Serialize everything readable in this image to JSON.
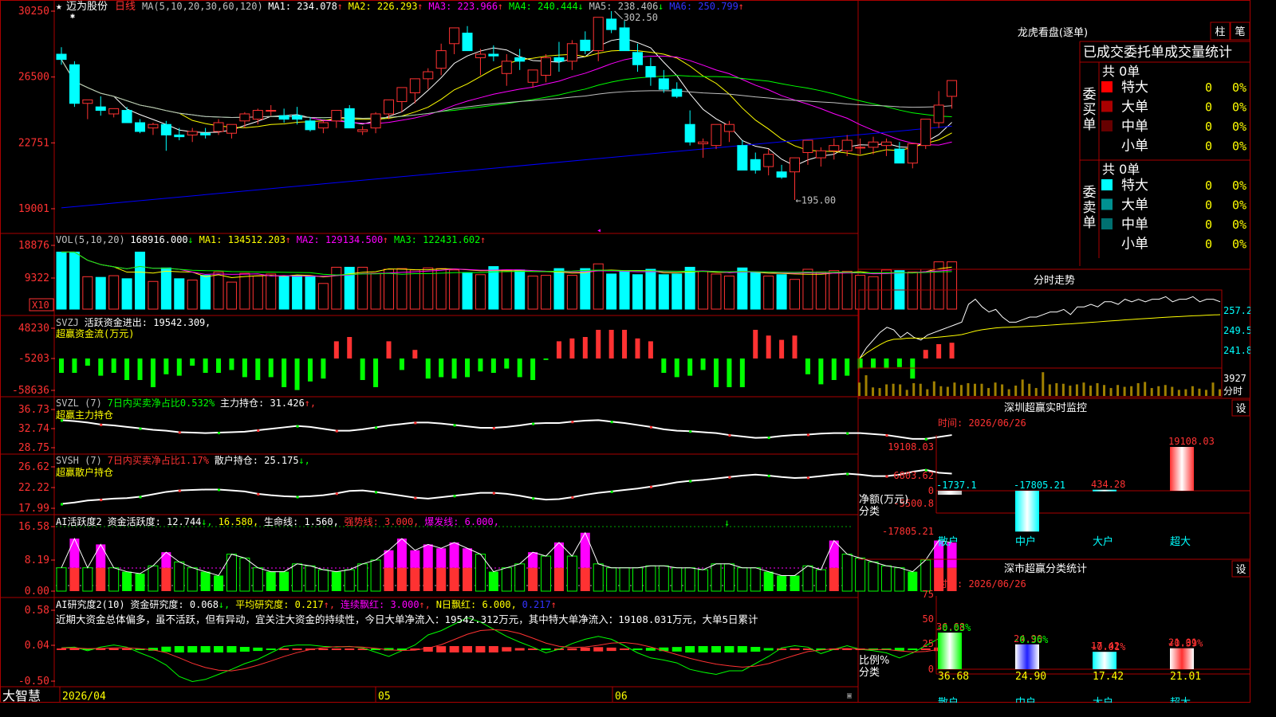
{
  "stock_name": "迈为股份",
  "period_label": "日线",
  "bottom_label": "大智慧",
  "colors": {
    "up": "#ff3232",
    "down": "#00ffff",
    "ma1": "#ffffff",
    "ma2": "#ffff00",
    "ma3": "#ff00ff",
    "ma4": "#00ff00",
    "ma5": "#c0c0c0",
    "ma6": "#0000ff",
    "bg": "#000000",
    "frame": "#aa0000",
    "pink": "#ff00ff",
    "green": "#00ff00",
    "gold": "#ffff00"
  },
  "main": {
    "ma_header": [
      {
        "t": "MA(5,10,20,30,60,120)",
        "c": "#c0c0c0"
      },
      {
        "t": "MA1: 234.078",
        "c": "#ffffff",
        "a": "↑",
        "ac": "#ff3232"
      },
      {
        "t": "MA2: 226.293",
        "c": "#ffff00",
        "a": "↑",
        "ac": "#ff3232"
      },
      {
        "t": "MA3: 223.966",
        "c": "#ff00ff",
        "a": "↑",
        "ac": "#ff3232"
      },
      {
        "t": "MA4: 240.444",
        "c": "#00ff00",
        "a": "↓",
        "ac": "#00ff00"
      },
      {
        "t": "MA5: 238.406",
        "c": "#c0c0c0",
        "a": "↓",
        "ac": "#00ff00"
      },
      {
        "t": "MA6: 250.799",
        "c": "#3333ff",
        "a": "↑",
        "ac": "#ff3232"
      }
    ],
    "y_ticks": [
      "30250",
      "26500",
      "22751",
      "19001"
    ],
    "high_label": "302.50",
    "low_label": "←195.00",
    "x_labels": [
      "2026/04",
      "05",
      "06"
    ]
  },
  "vol": {
    "header": [
      {
        "t": "VOL(5,10,20)",
        "c": "#c0c0c0"
      },
      {
        "t": "168916.000",
        "c": "#ffffff",
        "a": "↓",
        "ac": "#00ff00"
      },
      {
        "t": "MA1: 134512.203",
        "c": "#ffff00",
        "a": "↑",
        "ac": "#ff3232"
      },
      {
        "t": "MA2: 129134.500",
        "c": "#ff00ff",
        "a": "↑",
        "ac": "#ff3232"
      },
      {
        "t": "MA3: 122431.602",
        "c": "#00ff00",
        "a": "↑",
        "ac": "#ff3232"
      }
    ],
    "y_ticks": [
      "18876",
      "9322"
    ],
    "unit": "X10"
  },
  "svzj": {
    "header": [
      {
        "t": "SVZJ",
        "c": "#c0c0c0"
      },
      {
        "t": "活跃资金进出: 19542.309",
        "c": "#ffffff",
        "a": ",",
        "ac": "#ffffff"
      }
    ],
    "sub": "超赢资金流(万元)",
    "y_ticks": [
      "48230",
      "-5203",
      "-58636"
    ]
  },
  "svzl": {
    "header": [
      {
        "t": "SVZL (7)",
        "c": "#c0c0c0"
      },
      {
        "t": "7日内买卖净占比0.532%",
        "c": "#00ff00"
      },
      {
        "t": "主力持仓: 31.426",
        "c": "#ffffff",
        "a": "↑,",
        "ac": "#ff3232"
      }
    ],
    "sub": "超赢主力持仓",
    "y_ticks": [
      "36.73",
      "32.74",
      "28.75"
    ]
  },
  "svsh": {
    "header": [
      {
        "t": "SVSH (7)",
        "c": "#c0c0c0"
      },
      {
        "t": "7日内买卖净占比1.17%",
        "c": "#ff3232"
      },
      {
        "t": "散户持仓: 25.175",
        "c": "#ffffff",
        "a": "↓,",
        "ac": "#00ff00"
      }
    ],
    "sub": "超赢散户持仓",
    "y_ticks": [
      "26.62",
      "22.22",
      "17.99"
    ]
  },
  "aihy": {
    "header": [
      {
        "t": "AI活跃度2",
        "c": "#ffffff"
      },
      {
        "t": "资金活跃度: 12.744",
        "c": "#ffffff",
        "a": "↓,",
        "ac": "#00ff00"
      },
      {
        "t": "16.580,",
        "c": "#ffff00"
      },
      {
        "t": "生命线: 1.560,",
        "c": "#ffffff"
      },
      {
        "t": "强势线: 3.000,",
        "c": "#ff3232"
      },
      {
        "t": "爆发线: 6.000,",
        "c": "#ff00ff"
      }
    ],
    "y_ticks": [
      "16.58",
      "8.19",
      "0.00"
    ]
  },
  "aiyj": {
    "header": [
      {
        "t": "AI研究度2(10)",
        "c": "#ffffff"
      },
      {
        "t": "资金研究度: 0.068",
        "c": "#ffffff",
        "a": "↓,",
        "ac": "#00ff00"
      },
      {
        "t": "平均研究度: 0.217",
        "c": "#ffff00",
        "a": "↑,",
        "ac": "#ff3232"
      },
      {
        "t": "连续飘红: 3.000",
        "c": "#ff00ff",
        "a": "↑,",
        "ac": "#ff3232"
      },
      {
        "t": "N日飘红: 6.000,",
        "c": "#ffff00"
      },
      {
        "t": "0.217",
        "c": "#3333ff",
        "a": "↑",
        "ac": "#ff3232"
      }
    ],
    "comment": "近期大资金总体偏多，虽不活跃，但有异动，宜关注大资金的持续性，今日大单净流入：19542.312万元，其中特大单净流入：19108.031万元，大单5日累计",
    "y_ticks": [
      "0.58",
      "0.04",
      "-0.50"
    ]
  },
  "right": {
    "lhb": {
      "title": "龙虎看盘(逐单)",
      "btn1": "柱",
      "btn2": "笔",
      "subtitle": "已成交委托单成交量统计",
      "buy": {
        "side": "委买单",
        "total": "共 0单",
        "rows": [
          {
            "label": "特大",
            "color": "#ff0000",
            "v": "0",
            "p": "0%"
          },
          {
            "label": "大单",
            "color": "#aa0000",
            "v": "0",
            "p": "0%"
          },
          {
            "label": "中单",
            "color": "#660000",
            "v": "0",
            "p": "0%"
          },
          {
            "label": "小单",
            "color": "#000000",
            "v": "0",
            "p": "0%"
          }
        ]
      },
      "sell": {
        "side": "委卖单",
        "total": "共 0单",
        "rows": [
          {
            "label": "特大",
            "color": "#00ffff",
            "v": "0",
            "p": "0%"
          },
          {
            "label": "大单",
            "color": "#009090",
            "v": "0",
            "p": "0%"
          },
          {
            "label": "中单",
            "color": "#007070",
            "v": "0",
            "p": "0%"
          },
          {
            "label": "小单",
            "color": "#000000",
            "v": "0",
            "p": "0%"
          }
        ]
      }
    },
    "fenshi": {
      "title": "分时走势",
      "ticks": [
        "257.2",
        "249.5",
        "241.8"
      ],
      "vol_tick": "3927",
      "unit": "分时"
    },
    "monitor": {
      "title": "深圳超赢实时监控",
      "btn": "设",
      "time": "时间: 2026/06/26",
      "y_ticks": [
        "19108.03",
        "6803.62",
        "0",
        "-5500.8",
        "-17805.21"
      ],
      "y_label": "净额(万元)",
      "x_title": "分类",
      "chart_data": {
        "type": "bar",
        "categories": [
          "散户",
          "中户",
          "大户",
          "超大"
        ],
        "values": [
          -1737.1,
          -17805.21,
          434.28,
          19108.03
        ],
        "labels": [
          "-1737.1",
          "-17805.21",
          "434.28",
          "19108.03"
        ],
        "ylim": [
          -17805.21,
          19108.03
        ]
      }
    },
    "classify": {
      "title": "深市超赢分类统计",
      "btn": "设",
      "time": "时间: 2026/06/26",
      "y_ticks": [
        "75",
        "50",
        "25",
        "0"
      ],
      "y_label": "比例%",
      "x_title": "分类",
      "chart_data": {
        "type": "bar",
        "categories": [
          "散户",
          "中户",
          "大户",
          "超大"
        ],
        "values": [
          36.68,
          24.9,
          17.42,
          21.01
        ],
        "labels": [
          "36.68",
          "24.90",
          "17.42",
          "21.01"
        ],
        "changes": [
          "-0.03%",
          "-0.36%",
          "+0.01%",
          "+0.39%"
        ],
        "ylim": [
          0,
          75
        ]
      }
    }
  },
  "chart_data": {
    "type": "candlestick",
    "ylim": [
      190.01,
      302.5
    ],
    "candles": [
      [
        278,
        282,
        272,
        275
      ],
      [
        272,
        274,
        248,
        250
      ],
      [
        250,
        252,
        241,
        252
      ],
      [
        248,
        254,
        243,
        246
      ],
      [
        244,
        247,
        242,
        247
      ],
      [
        246,
        248,
        239,
        239
      ],
      [
        239,
        241,
        233,
        234
      ],
      [
        236,
        239,
        232,
        238
      ],
      [
        238,
        240,
        223,
        232
      ],
      [
        232,
        236,
        229,
        231
      ],
      [
        232,
        236,
        228,
        234
      ],
      [
        233,
        236,
        230,
        232
      ],
      [
        234,
        241,
        232,
        239
      ],
      [
        233,
        238,
        230,
        238
      ],
      [
        240,
        245,
        236,
        244
      ],
      [
        241,
        247,
        238,
        246
      ],
      [
        246,
        249,
        243,
        246
      ],
      [
        243,
        247,
        239,
        241
      ],
      [
        243,
        248,
        238,
        241
      ],
      [
        240,
        242,
        234,
        235
      ],
      [
        236,
        240,
        233,
        239
      ],
      [
        240,
        246,
        236,
        246
      ],
      [
        247,
        249,
        236,
        236
      ],
      [
        234,
        237,
        232,
        235
      ],
      [
        236,
        245,
        233,
        244
      ],
      [
        244,
        252,
        241,
        252
      ],
      [
        251,
        259,
        245,
        259
      ],
      [
        256,
        264,
        250,
        264
      ],
      [
        264,
        270,
        258,
        268
      ],
      [
        270,
        284,
        266,
        280
      ],
      [
        284,
        293,
        278,
        293
      ],
      [
        290,
        294,
        280,
        280
      ],
      [
        276,
        281,
        266,
        278
      ],
      [
        278,
        283,
        274,
        277
      ],
      [
        267,
        278,
        260,
        274
      ],
      [
        276,
        281,
        269,
        274
      ],
      [
        262,
        269,
        259,
        269
      ],
      [
        266,
        278,
        262,
        276
      ],
      [
        276,
        285,
        268,
        274
      ],
      [
        274,
        286,
        269,
        284
      ],
      [
        286,
        291,
        278,
        280
      ],
      [
        280,
        299,
        274,
        299
      ],
      [
        298,
        302.5,
        290,
        292
      ],
      [
        293,
        297,
        280,
        280
      ],
      [
        279,
        284,
        268,
        272
      ],
      [
        271,
        276,
        260,
        265
      ],
      [
        264,
        269,
        256,
        258
      ],
      [
        258,
        262,
        253,
        254
      ],
      [
        238,
        246,
        226,
        228
      ],
      [
        227,
        230,
        219,
        228
      ],
      [
        226,
        238,
        224,
        238
      ],
      [
        234,
        240,
        228,
        238
      ],
      [
        226,
        229,
        216,
        212
      ],
      [
        218,
        222,
        210,
        212
      ],
      [
        214,
        224,
        209,
        221
      ],
      [
        211,
        215,
        207,
        208
      ],
      [
        211,
        219,
        195,
        219
      ],
      [
        222,
        229,
        215,
        229
      ],
      [
        219,
        225,
        214,
        223
      ],
      [
        223,
        230,
        218,
        226
      ],
      [
        223,
        232,
        220,
        229
      ],
      [
        225,
        230,
        221,
        225
      ],
      [
        225,
        231,
        221,
        228
      ],
      [
        226,
        230,
        220,
        228
      ],
      [
        224,
        228,
        217,
        216
      ],
      [
        216,
        226,
        213,
        227
      ],
      [
        226,
        241,
        224,
        241
      ],
      [
        239,
        257,
        236,
        249
      ],
      [
        254,
        261,
        247,
        263
      ]
    ],
    "volume": [
      168916,
      168916,
      96000,
      94000,
      99000,
      90000,
      168916,
      82000,
      122000,
      90000,
      86000,
      100000,
      110000,
      80000,
      106000,
      98000,
      104000,
      98000,
      100000,
      98000,
      76000,
      124000,
      124000,
      124000,
      106000,
      118000,
      120000,
      116000,
      122000,
      120000,
      116000,
      108000,
      102000,
      126000,
      116000,
      116000,
      98000,
      100000,
      120000,
      100000,
      120000,
      134000,
      104000,
      112000,
      102000,
      118000,
      102000,
      104000,
      124000,
      112000,
      104000,
      98000,
      122000,
      110000,
      98000,
      102000,
      88000,
      118000,
      110000,
      114000,
      112000,
      100000,
      96000,
      116000,
      114000,
      110000,
      118000,
      140000,
      140000
    ],
    "svzj": [
      -10,
      -10,
      -5,
      -12,
      -10,
      -15,
      -15,
      -20,
      -11,
      -12,
      -5,
      -10,
      -10,
      -8,
      -13,
      -15,
      -13,
      -20,
      -22,
      -16,
      -14,
      12,
      15,
      -15,
      -20,
      12,
      -8,
      6,
      -14,
      -13,
      -14,
      -13,
      -9,
      -10,
      -7,
      -13,
      -15,
      -1,
      12,
      14,
      15,
      20,
      20,
      20,
      14,
      12,
      -10,
      -13,
      -12,
      -8,
      -20,
      -20,
      -20,
      20,
      16,
      13,
      16,
      -11,
      -18,
      -15,
      -12,
      -7,
      -7,
      -7,
      -6,
      -14,
      6,
      10,
      11
    ],
    "svzl": [
      34.5,
      34.3,
      34.0,
      33.6,
      33.4,
      33.1,
      32.8,
      32.5,
      32.3,
      32.0,
      31.9,
      31.8,
      31.9,
      32.0,
      32.1,
      32.4,
      32.7,
      33.0,
      33.3,
      33.1,
      32.7,
      32.3,
      32.3,
      32.6,
      33.0,
      33.4,
      33.7,
      34.0,
      34.0,
      33.8,
      33.5,
      33.2,
      32.9,
      32.9,
      33.1,
      33.4,
      33.8,
      33.9,
      33.9,
      34.2,
      34.4,
      34.5,
      34.2,
      33.9,
      33.5,
      33.1,
      32.6,
      32.3,
      32.2,
      32.0,
      31.8,
      31.4,
      31.1,
      30.8,
      30.9,
      31.2,
      31.4,
      31.5,
      31.7,
      31.8,
      31.8,
      31.8,
      31.6,
      31.4,
      31.0,
      30.6,
      30.6,
      31.0,
      31.4
    ],
    "svsh": [
      18.9,
      19.2,
      19.6,
      19.8,
      20.0,
      20.1,
      20.4,
      20.9,
      21.4,
      21.7,
      21.8,
      21.9,
      21.9,
      21.7,
      21.5,
      21.0,
      20.7,
      20.5,
      20.4,
      20.5,
      20.7,
      21.1,
      21.6,
      21.7,
      21.4,
      21.0,
      20.6,
      20.2,
      20.0,
      20.3,
      20.6,
      20.9,
      21.2,
      21.2,
      21.0,
      20.6,
      20.1,
      19.8,
      19.9,
      20.3,
      20.8,
      21.2,
      21.5,
      21.8,
      22.1,
      22.5,
      22.9,
      23.4,
      23.7,
      23.9,
      24.2,
      24.5,
      24.8,
      25.0,
      24.8,
      24.5,
      24.3,
      24.4,
      24.7,
      25.0,
      25.2,
      25.0,
      24.7,
      24.7,
      25.0,
      25.6,
      26.0,
      25.4,
      25.2
    ],
    "aihy": [
      6.0,
      13.5,
      6.0,
      12.0,
      6.0,
      5.0,
      4.5,
      6.5,
      10.0,
      7.5,
      6.0,
      5.0,
      4.0,
      9.5,
      8.5,
      6.0,
      5.0,
      5.0,
      7.0,
      6.5,
      5.5,
      5.0,
      5.5,
      7.0,
      8.0,
      10.5,
      13.5,
      10.5,
      12.0,
      11.0,
      12.5,
      11.0,
      9.5,
      5.0,
      6.0,
      7.0,
      10.0,
      9.0,
      12.5,
      9.0,
      15.0,
      7.0,
      6.0,
      6.0,
      6.0,
      6.5,
      6.5,
      6.0,
      6.0,
      5.5,
      7.0,
      7.0,
      6.0,
      6.0,
      5.0,
      4.0,
      4.0,
      6.5,
      5.5,
      13.0,
      9.5,
      8.5,
      7.5,
      6.5,
      6.0,
      5.0,
      8.0,
      13.0,
      12.5
    ],
    "aiyj": [
      0.02,
      0.03,
      -0.02,
      0.03,
      0.06,
      0.03,
      -0.05,
      -0.12,
      -0.22,
      -0.38,
      -0.45,
      -0.42,
      -0.35,
      -0.28,
      -0.2,
      -0.14,
      -0.05,
      0.04,
      0.06,
      0.06,
      0.04,
      0.03,
      0.04,
      0.02,
      -0.04,
      -0.1,
      -0.02,
      0.06,
      0.2,
      0.26,
      0.35,
      0.44,
      0.38,
      0.28,
      0.18,
      0.1,
      0.03,
      -0.05,
      0.0,
      0.08,
      0.14,
      0.18,
      0.14,
      0.05,
      -0.05,
      -0.12,
      -0.15,
      -0.19,
      -0.28,
      -0.32,
      -0.35,
      -0.3,
      -0.3,
      -0.2,
      -0.1,
      0.02,
      0.05,
      0.03,
      -0.06,
      0.0,
      0.05,
      0.0,
      -0.02,
      -0.05,
      -0.12,
      -0.05,
      0.05,
      0.15,
      0.1
    ],
    "fenshi_price": [
      241.8,
      246,
      249,
      252,
      254,
      253,
      250,
      252,
      250,
      249,
      251,
      252,
      253,
      254,
      255,
      256,
      263,
      265,
      262,
      260,
      261,
      258,
      256,
      256,
      257,
      258,
      258,
      259,
      260,
      260,
      261,
      259,
      262,
      262,
      263,
      262,
      264,
      264,
      263,
      265,
      264,
      265,
      264,
      265,
      265,
      266,
      264,
      265,
      265,
      266,
      264,
      265,
      265,
      264
    ],
    "fenshi_vol": [
      2200,
      3400,
      1400,
      1300,
      1900,
      2000,
      1900,
      1000,
      2100,
      2000,
      1100,
      2400,
      1600,
      1500,
      2200,
      1800,
      2100,
      2000,
      2000,
      1300,
      2200,
      1900,
      1100,
      1700,
      2700,
      2000,
      1300,
      3900,
      1900,
      2100,
      2000,
      1700,
      1900,
      2200,
      1700,
      2100,
      1800,
      1300,
      1800,
      1500,
      1600,
      2100,
      2300,
      1300,
      1600,
      1800,
      1500,
      1000,
      1100,
      1600,
      1200,
      1000,
      2200,
      1100
    ]
  }
}
